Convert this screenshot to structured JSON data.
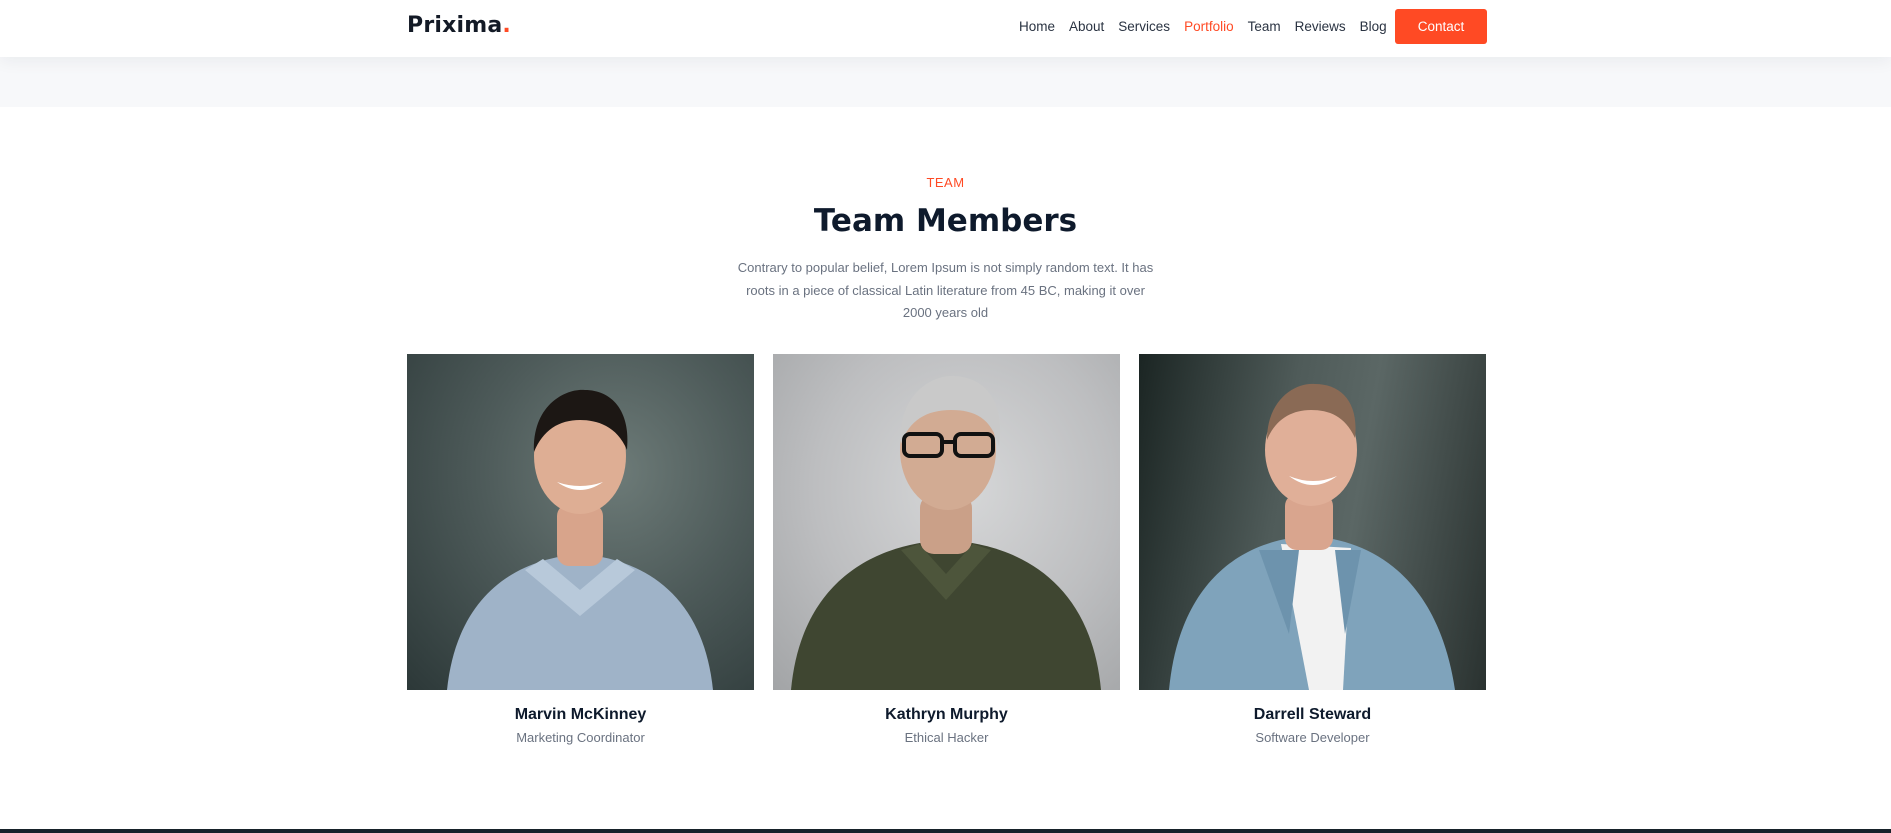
{
  "brand": {
    "name": "Prixima",
    "dot": "."
  },
  "nav": {
    "items": [
      {
        "label": "Home"
      },
      {
        "label": "About"
      },
      {
        "label": "Services"
      },
      {
        "label": "Portfolio",
        "active": true
      },
      {
        "label": "Team"
      },
      {
        "label": "Reviews"
      },
      {
        "label": "Blog"
      }
    ],
    "contact_label": "Contact"
  },
  "section": {
    "label": "TEAM",
    "title": "Team Members",
    "description": "Contrary to popular belief, Lorem Ipsum is not simply random text. It has roots in a piece of classical Latin literature from 45 BC, making it over 2000 years old"
  },
  "team": [
    {
      "name": "Marvin McKinney",
      "role": "Marketing Coordinator"
    },
    {
      "name": "Kathryn Murphy",
      "role": "Ethical Hacker"
    },
    {
      "name": "Darrell Steward",
      "role": "Software Developer"
    }
  ],
  "colors": {
    "accent": "#ff4a24",
    "heading": "#0e1a2c",
    "muted": "#6a7280"
  }
}
